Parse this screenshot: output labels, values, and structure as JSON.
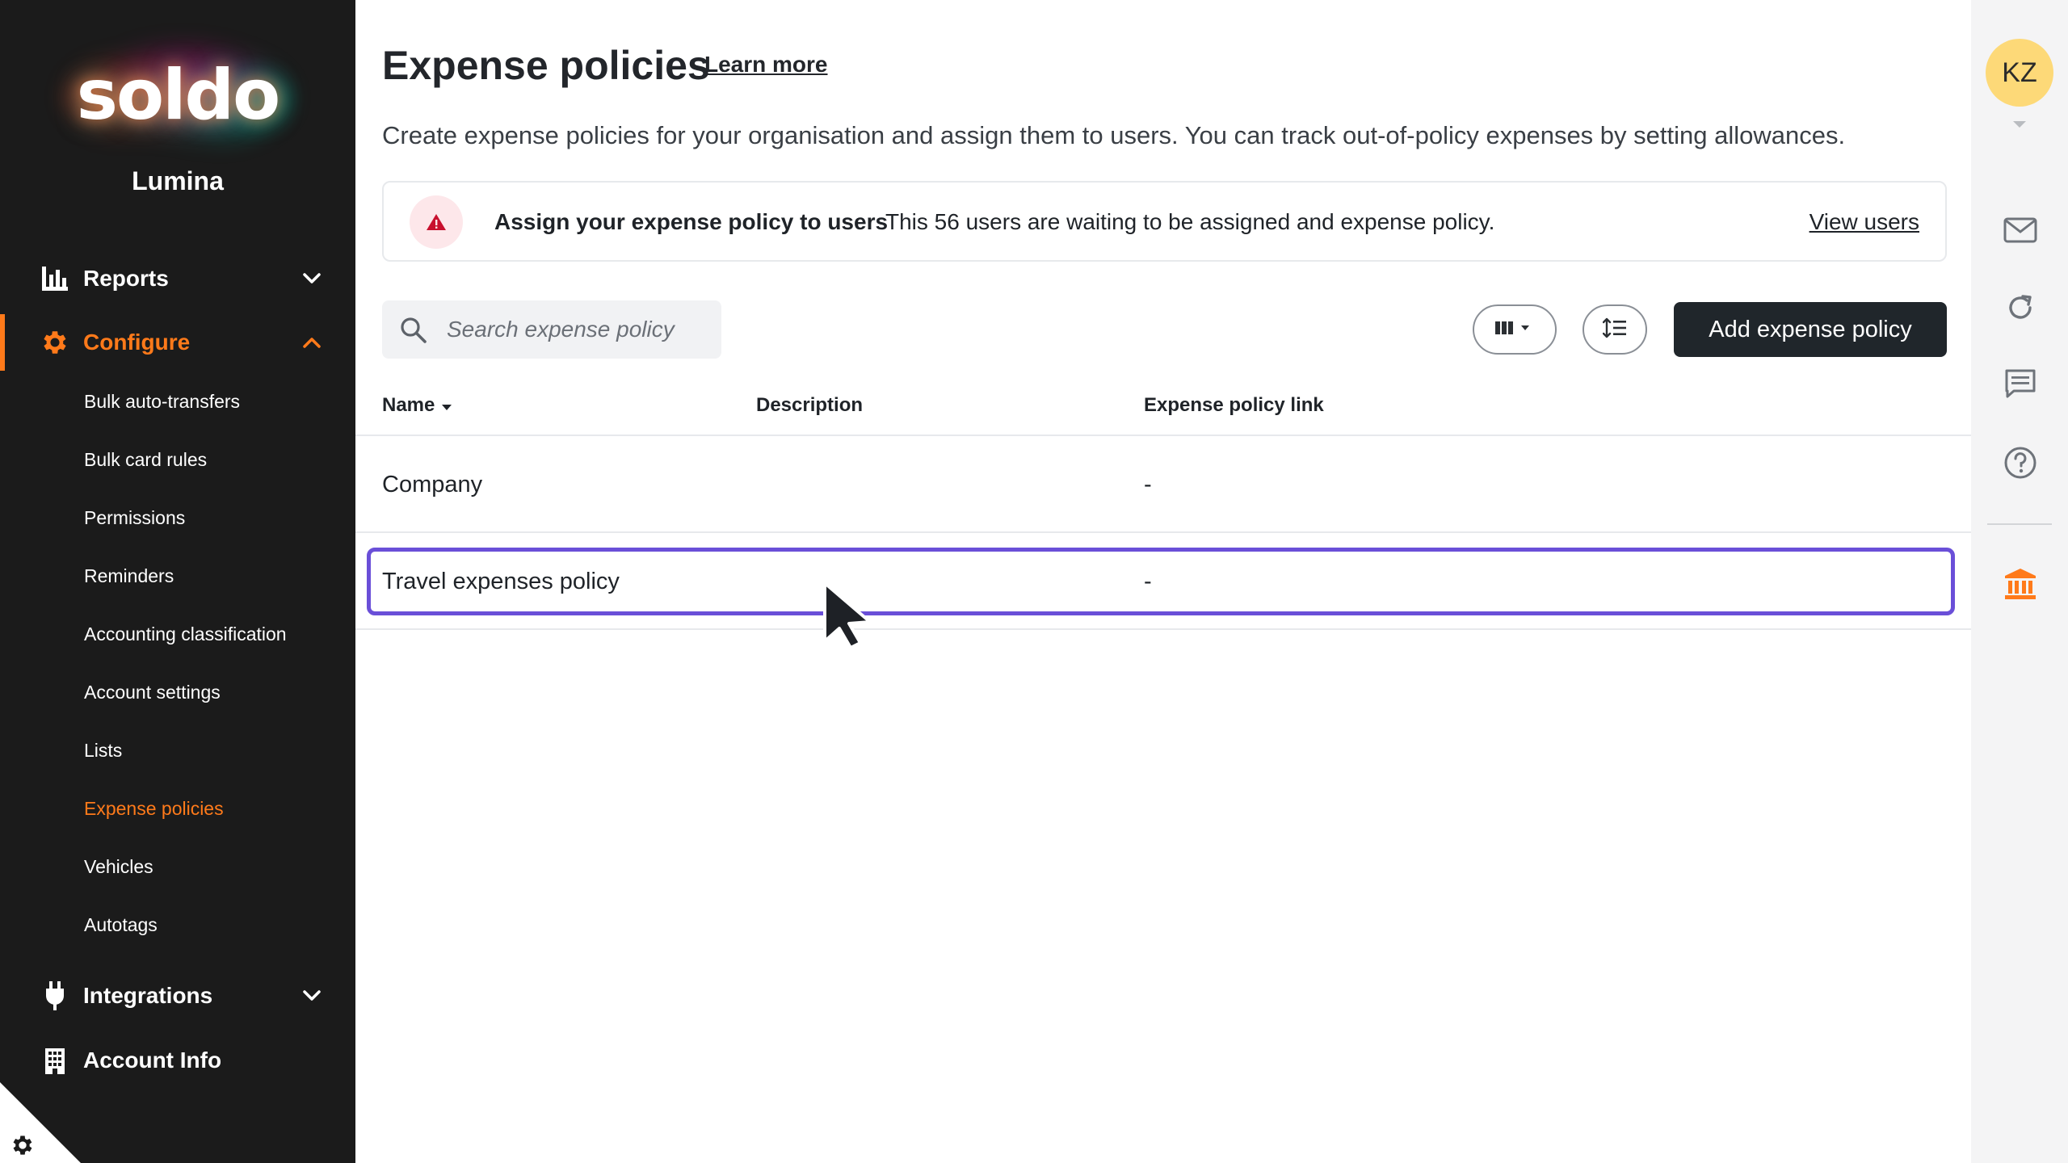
{
  "brand": {
    "logo": "soldo",
    "org_name": "Lumina",
    "accent": "#ff7a1a"
  },
  "sidebar": {
    "nav": [
      {
        "label": "Reports",
        "icon": "bar-chart-icon",
        "expanded": false
      },
      {
        "label": "Configure",
        "icon": "gear-icon",
        "expanded": true
      },
      {
        "label": "Integrations",
        "icon": "plug-icon",
        "expanded": false
      },
      {
        "label": "Account Info",
        "icon": "building-icon"
      }
    ],
    "configure_items": [
      "Bulk auto-transfers",
      "Bulk card rules",
      "Permissions",
      "Reminders",
      "Accounting classification",
      "Account settings",
      "Lists",
      "Expense policies",
      "Vehicles",
      "Autotags"
    ],
    "active_item": "Expense policies"
  },
  "header": {
    "title": "Expense policies",
    "learn_more": "Learn more",
    "description": "Create expense policies for your organisation and assign them to users. You can track out-of-policy expenses by setting allowances."
  },
  "banner": {
    "icon": "warning-icon",
    "title": "Assign your expense policy to users",
    "text": "This 56 users are waiting to be assigned and expense policy.",
    "link": "View users"
  },
  "toolbar": {
    "search_placeholder": "Search expense policy",
    "add_label": "Add expense policy"
  },
  "table": {
    "columns": [
      "Name",
      "Description",
      "Expense policy link"
    ],
    "sort_column": "Name",
    "rows": [
      {
        "name": "Company",
        "description": "",
        "link": "-"
      },
      {
        "name": "Travel expenses policy",
        "description": "",
        "link": "-"
      }
    ],
    "highlighted_row": 1
  },
  "rail": {
    "avatar_initials": "KZ",
    "icons": [
      "mail-icon",
      "refresh-icon",
      "chat-icon",
      "help-icon",
      "bank-icon"
    ]
  }
}
